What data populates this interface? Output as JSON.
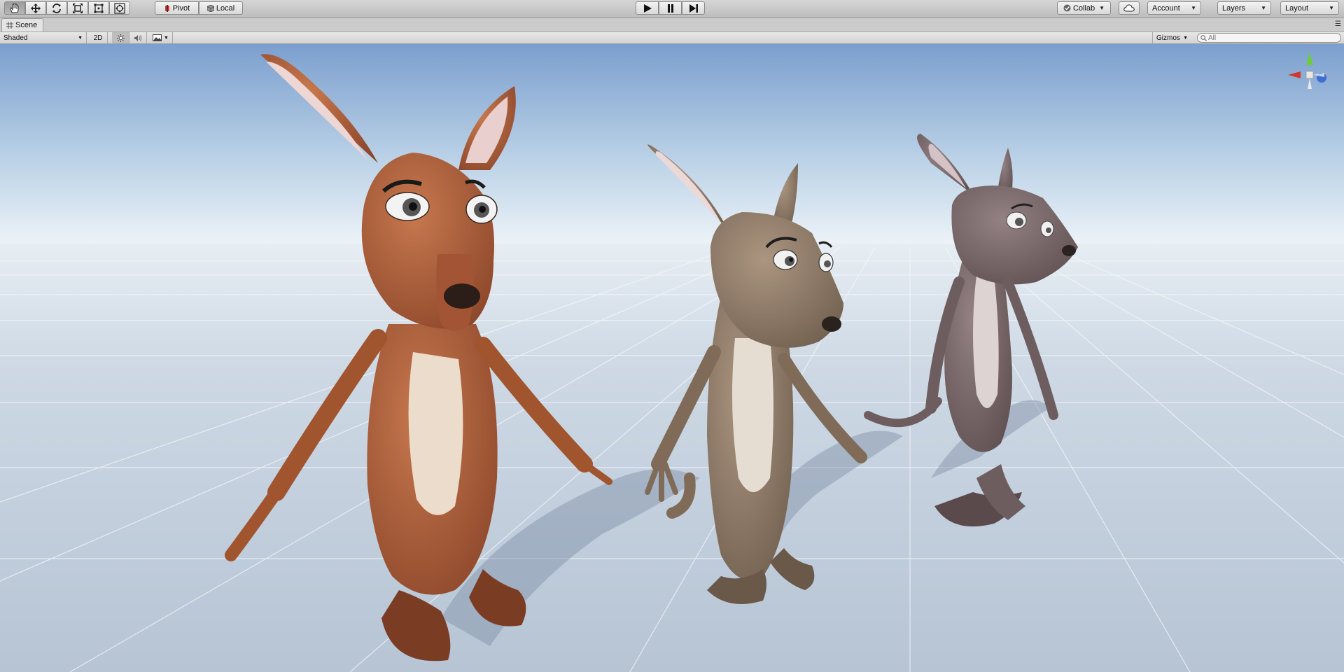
{
  "toolbar": {
    "tools": [
      "hand-tool",
      "move-tool",
      "rotate-tool",
      "scale-tool",
      "rect-tool",
      "transform-tool"
    ],
    "pivot_label": "Pivot",
    "local_label": "Local",
    "collab_label": "Collab",
    "account_label": "Account",
    "layers_label": "Layers",
    "layout_label": "Layout"
  },
  "tab": {
    "label": "Scene"
  },
  "scene_toolbar": {
    "draw_mode": "Shaded",
    "toggle_2d": "2D",
    "gizmos_label": "Gizmos",
    "search_placeholder": "All"
  },
  "viewport": {
    "sky_top": "#7b9fce",
    "horizon": "#eef4f8",
    "ground": "#c9d5e2",
    "characters": [
      {
        "name": "kangaroo-orange",
        "body": "#b0603c",
        "belly": "#ecdccb"
      },
      {
        "name": "kangaroo-tan",
        "body": "#98826c",
        "belly": "#e6ddd2"
      },
      {
        "name": "kangaroo-grey",
        "body": "#7f6c6d",
        "belly": "#ddd3d3"
      }
    ]
  },
  "colors": {
    "gizmo_x": "#d03a2a",
    "gizmo_y": "#6ccc3a",
    "gizmo_z": "#3a6fd6"
  }
}
